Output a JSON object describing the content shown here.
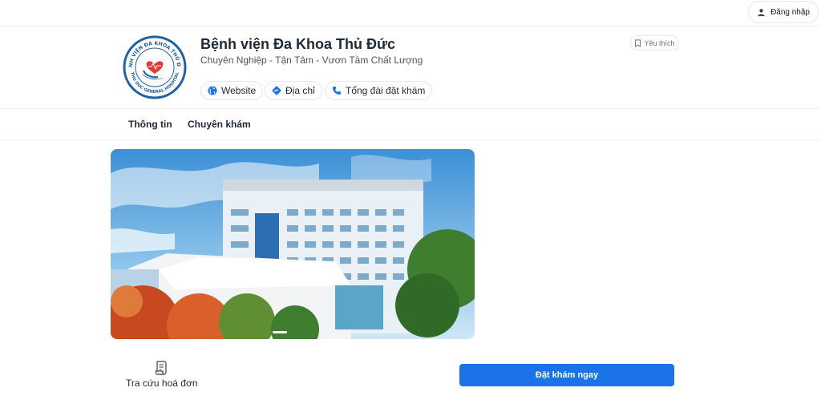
{
  "topbar": {
    "login_label": "Đăng nhập",
    "login_icon": "user-icon"
  },
  "hospital": {
    "name": "Bệnh viện Đa Khoa Thủ Đức",
    "slogan": "Chuyên Nghiệp - Tận Tâm - Vươn Tầm Chất Lượng",
    "logo_text_top": "BỆNH VIỆN ĐA KHOA THỦ ĐỨC",
    "logo_text_bottom": "THU DUC GENERAL HOSPITAL",
    "favorite_label": "Yêu thích"
  },
  "chips": [
    {
      "label": "Website",
      "icon": "globe-icon"
    },
    {
      "label": "Địa chỉ",
      "icon": "direction-icon"
    },
    {
      "label": "Tổng đài đặt khám",
      "icon": "phone-icon"
    }
  ],
  "tabs": [
    {
      "label": "Thông tin"
    },
    {
      "label": "Chuyên khám"
    }
  ],
  "actions": {
    "invoice_label": "Tra cứu hoá đơn",
    "invoice_icon": "receipt-icon",
    "book_label": "Đặt khám ngay"
  },
  "colors": {
    "primary": "#1a73e8",
    "logo_blue": "#1f5fa8",
    "heart_red": "#e53935"
  }
}
